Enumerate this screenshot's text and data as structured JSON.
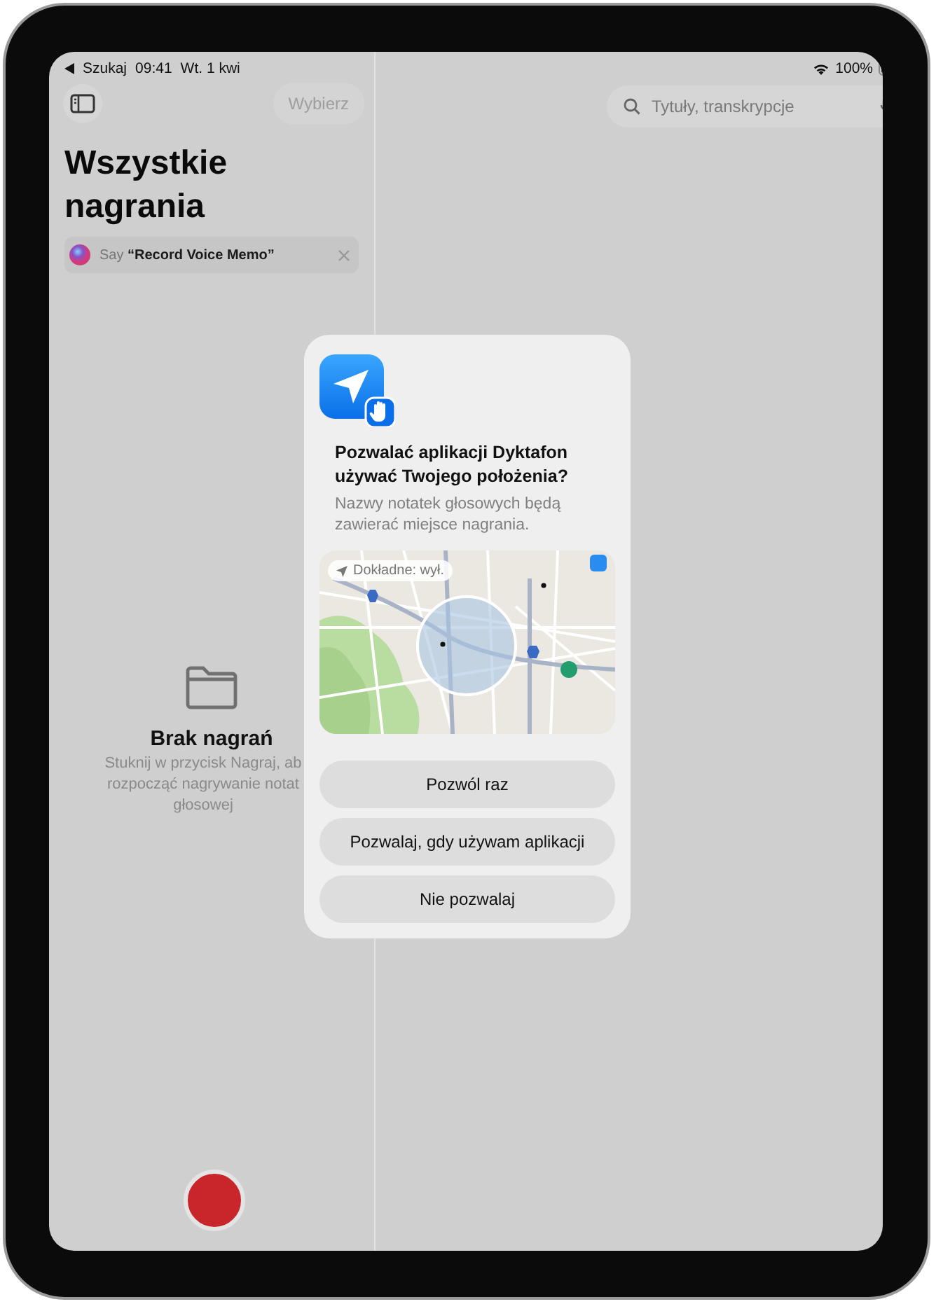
{
  "status_bar": {
    "back_label": "Szukaj",
    "time": "09:41",
    "date": "Wt. 1 kwi",
    "battery": "100%"
  },
  "sidebar": {
    "select_button": "Wybierz",
    "title": "Wszystkie nagrania",
    "siri_tip": "Say **“Record Voice Memo”**",
    "empty_state": {
      "title": "Brak nagrań",
      "lines": [
        "Stuknij w przycisk Nagraj, ab",
        "rozpocząć nagrywanie notat",
        "głosowej"
      ]
    }
  },
  "search": {
    "placeholder": "Tytuły, transkrypcje"
  },
  "alert": {
    "title": "Pozwalać aplikacji Dyktafon używać Twojego położenia?",
    "message": "Nazwy notatek głosowych będą zawierać miejsce nagrania.",
    "map": {
      "precise_label": "Dokładne: wył."
    },
    "buttons": [
      "Pozwól raz",
      "Pozwalaj, gdy używam aplikacji",
      "Nie pozwalaj"
    ]
  }
}
